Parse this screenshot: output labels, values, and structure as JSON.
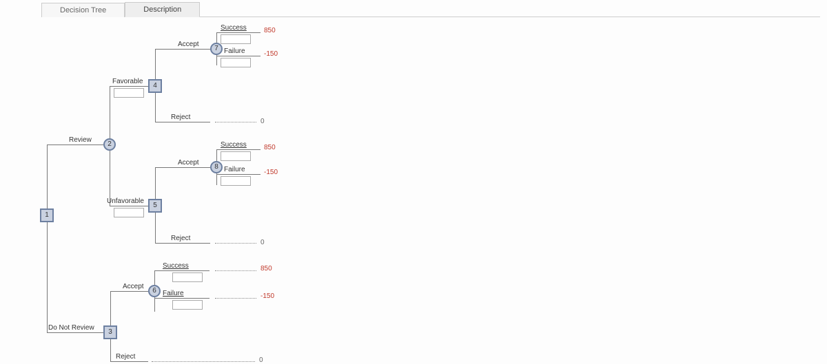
{
  "tabs": {
    "t1": "Decision Tree",
    "t2": "Description"
  },
  "branches": {
    "review": "Review",
    "doNotReview": "Do Not Review",
    "favorable": "Favorable",
    "unfavorable": "Unfavorable",
    "accept": "Accept",
    "reject": "Reject",
    "success": "Success",
    "failure": "Failure"
  },
  "nodes": {
    "n1": "1",
    "n2": "2",
    "n3": "3",
    "n4": "4",
    "n5": "5",
    "n6": "6",
    "n7": "7",
    "n8": "8"
  },
  "payoffs": {
    "p850": "850",
    "m150": "-150",
    "zero": "0"
  },
  "chart_data": {
    "type": "decision-tree",
    "root": {
      "id": 1,
      "kind": "decision",
      "children": [
        {
          "label": "Review",
          "node": {
            "id": 2,
            "kind": "chance",
            "children": [
              {
                "label": "Favorable",
                "node": {
                  "id": 4,
                  "kind": "decision",
                  "children": [
                    {
                      "label": "Accept",
                      "node": {
                        "id": 7,
                        "kind": "chance",
                        "children": [
                          {
                            "label": "Success",
                            "payoff": 850
                          },
                          {
                            "label": "Failure",
                            "payoff": -150
                          }
                        ]
                      }
                    },
                    {
                      "label": "Reject",
                      "payoff": 0
                    }
                  ]
                }
              },
              {
                "label": "Unfavorable",
                "node": {
                  "id": 5,
                  "kind": "decision",
                  "children": [
                    {
                      "label": "Accept",
                      "node": {
                        "id": 8,
                        "kind": "chance",
                        "children": [
                          {
                            "label": "Success",
                            "payoff": 850
                          },
                          {
                            "label": "Failure",
                            "payoff": -150
                          }
                        ]
                      }
                    },
                    {
                      "label": "Reject",
                      "payoff": 0
                    }
                  ]
                }
              }
            ]
          }
        },
        {
          "label": "Do Not Review",
          "node": {
            "id": 3,
            "kind": "decision",
            "children": [
              {
                "label": "Accept",
                "node": {
                  "id": 6,
                  "kind": "chance",
                  "children": [
                    {
                      "label": "Success",
                      "payoff": 850
                    },
                    {
                      "label": "Failure",
                      "payoff": -150
                    }
                  ]
                }
              },
              {
                "label": "Reject",
                "payoff": 0
              }
            ]
          }
        }
      ]
    }
  }
}
